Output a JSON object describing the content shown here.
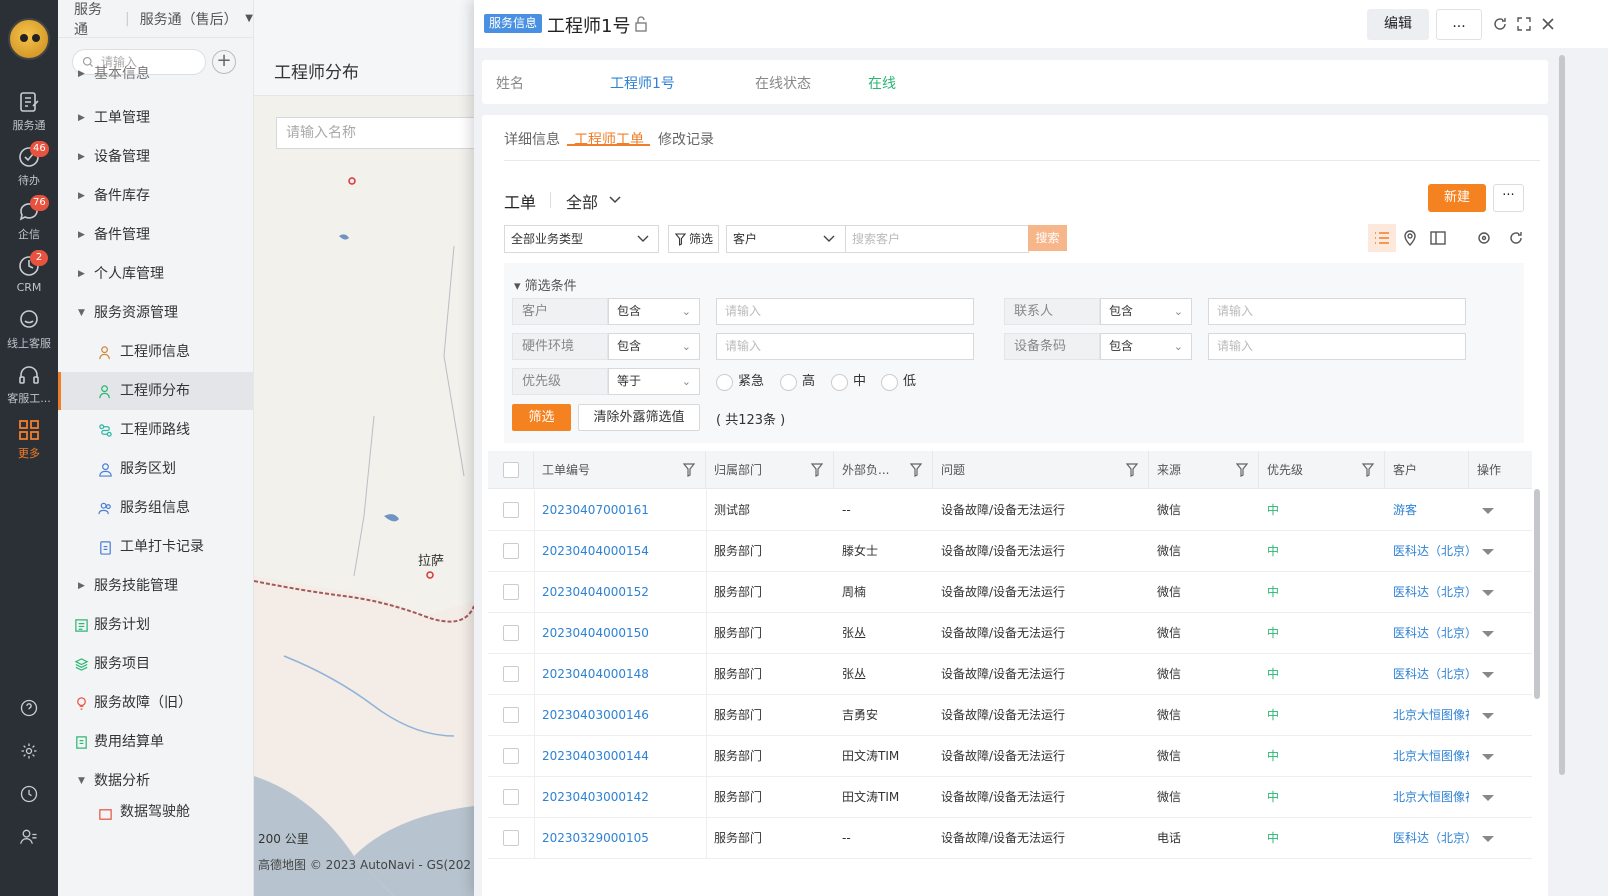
{
  "rail": {
    "items": [
      {
        "label": "服务通",
        "icon": "service-icon"
      },
      {
        "label": "待办",
        "badge": "46",
        "icon": "todo-icon"
      },
      {
        "label": "企信",
        "badge": "76",
        "icon": "chat-icon"
      },
      {
        "label": "CRM",
        "badge": "2",
        "icon": "crm-icon"
      },
      {
        "label": "线上客服",
        "icon": "online-service-icon"
      },
      {
        "label": "客服工...",
        "icon": "headset-icon"
      },
      {
        "label": "更多",
        "icon": "grid-icon"
      }
    ]
  },
  "leftnav": {
    "app": "服务通",
    "module": "服务通（售后）",
    "search_placeholder": "请输入",
    "partial_top": "基本信息",
    "items": [
      "工单管理",
      "设备管理",
      "备件库存",
      "备件管理",
      "个人库管理",
      "服务资源管理",
      "工程师信息",
      "工程师分布",
      "工程师路线",
      "服务区划",
      "服务组信息",
      "工单打卡记录",
      "服务技能管理",
      "服务计划",
      "服务项目",
      "服务故障（旧）",
      "费用结算单",
      "数据分析",
      "数据驾驶舱"
    ]
  },
  "map": {
    "title": "工程师分布",
    "input_placeholder": "请输入名称",
    "city": "拉萨",
    "scale": "200 公里",
    "copyright": "高德地图 © 2023 AutoNavi - GS(202"
  },
  "drawer": {
    "tag": "服务信息",
    "title": "工程师1号",
    "edit_label": "编辑",
    "more_label": "...",
    "name_label": "姓名",
    "name_value": "工程师1号",
    "status_label": "在线状态",
    "status_value": "在线",
    "tabs": [
      "详细信息",
      "工程师工单",
      "修改记录"
    ],
    "section_title": "工单",
    "section_scope": "全部",
    "new_label": "新建",
    "dots_label": "···",
    "biz_type": "全部业务类型",
    "filter_btn": "筛选",
    "customer_select": "客户",
    "search_placeholder": "搜索客户",
    "search_btn": "搜索",
    "filter_box": {
      "title": "筛选条件",
      "rows": [
        {
          "label": "客户",
          "op": "包含",
          "ph": "请输入"
        },
        {
          "label": "联系人",
          "op": "包含",
          "ph": "请输入"
        },
        {
          "label": "硬件环境",
          "op": "包含",
          "ph": "请输入"
        },
        {
          "label": "设备条码",
          "op": "包含",
          "ph": "请输入"
        },
        {
          "label": "优先级",
          "op": "等于"
        }
      ],
      "priorities": [
        "紧急",
        "高",
        "中",
        "低"
      ],
      "apply": "筛选",
      "clear": "清除外露筛选值",
      "count": "( 共123条 )"
    },
    "table": {
      "headers": [
        "工单编号",
        "归属部门",
        "外部负...",
        "问题",
        "来源",
        "优先级",
        "客户",
        "操作"
      ],
      "rows": [
        [
          "20230407000161",
          "测试部",
          "--",
          "设备故障/设备无法运行",
          "微信",
          "中",
          "游客"
        ],
        [
          "20230404000154",
          "服务部门",
          "滕女士",
          "设备故障/设备无法运行",
          "微信",
          "中",
          "医科达（北京）"
        ],
        [
          "20230404000152",
          "服务部门",
          "周楠",
          "设备故障/设备无法运行",
          "微信",
          "中",
          "医科达（北京）"
        ],
        [
          "20230404000150",
          "服务部门",
          "张丛",
          "设备故障/设备无法运行",
          "微信",
          "中",
          "医科达（北京）"
        ],
        [
          "20230404000148",
          "服务部门",
          "张丛",
          "设备故障/设备无法运行",
          "微信",
          "中",
          "医科达（北京）"
        ],
        [
          "20230403000146",
          "服务部门",
          "吉勇安",
          "设备故障/设备无法运行",
          "微信",
          "中",
          "北京大恒图像视"
        ],
        [
          "20230403000144",
          "服务部门",
          "田文涛TIM",
          "设备故障/设备无法运行",
          "微信",
          "中",
          "北京大恒图像视"
        ],
        [
          "20230403000142",
          "服务部门",
          "田文涛TIM",
          "设备故障/设备无法运行",
          "微信",
          "中",
          "北京大恒图像视"
        ],
        [
          "20230329000105",
          "服务部门",
          "--",
          "设备故障/设备无法运行",
          "电话",
          "中",
          "医科达（北京）"
        ]
      ]
    }
  },
  "colors": {
    "accent": "#f58220",
    "link": "#2e82d4",
    "online": "#2bb673",
    "rail": "#2b2f36"
  }
}
